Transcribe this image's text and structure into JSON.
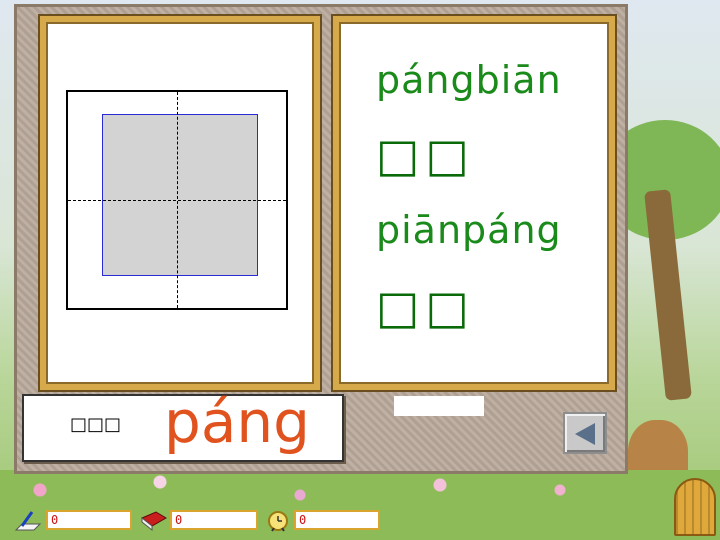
{
  "words": [
    {
      "pinyin": "pángbiān",
      "hanzi": "□□"
    },
    {
      "pinyin": "piānpáng",
      "hanzi": "□□"
    }
  ],
  "current": {
    "label": "□□□",
    "syllable": "páng"
  },
  "status": {
    "writing_count": "0",
    "book_count": "0",
    "clock_count": "0"
  },
  "icons": {
    "writing": "pencil-paper-icon",
    "book": "book-icon",
    "clock": "alarm-clock-icon",
    "back": "back-arrow-icon",
    "exit": "door-icon"
  },
  "colors": {
    "pinyin": "#1a8a1a",
    "syllable": "#e0521e",
    "frame": "#d6a94b"
  }
}
